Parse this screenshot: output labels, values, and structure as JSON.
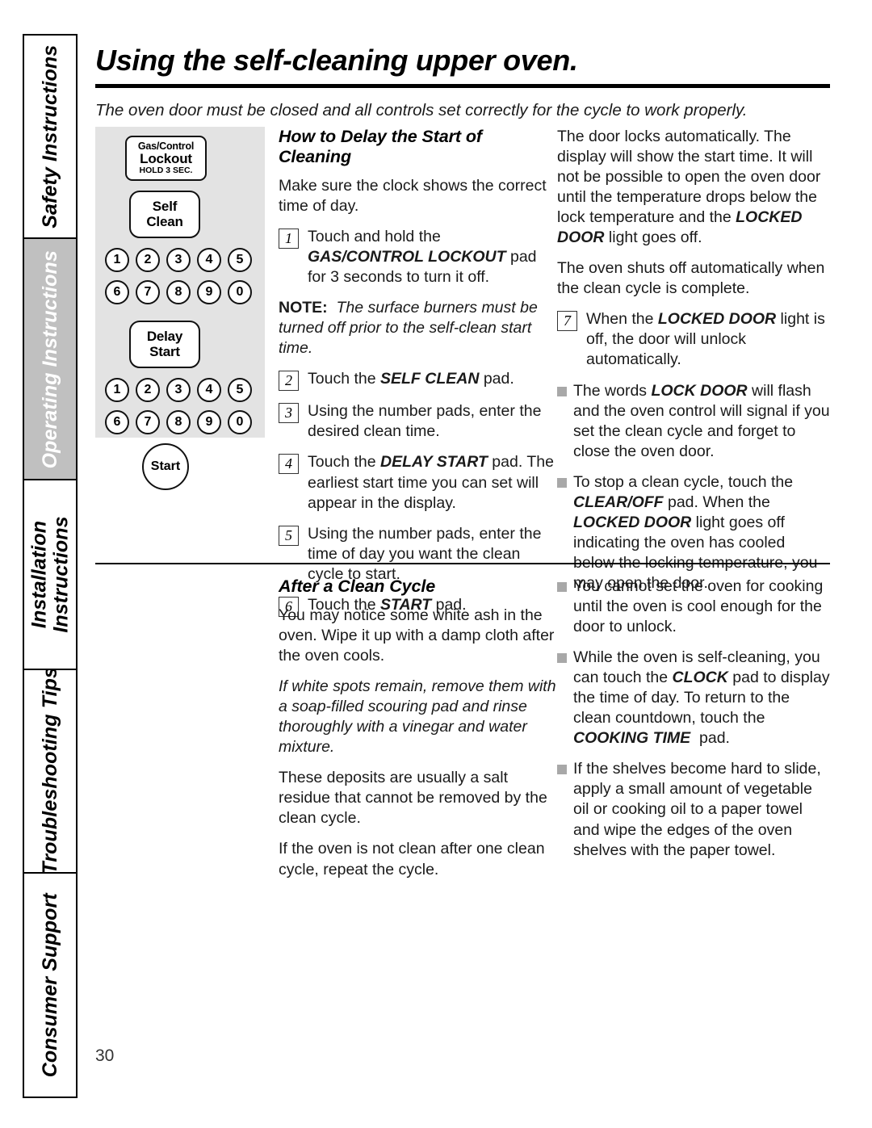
{
  "sidebar": {
    "tabs": [
      {
        "label": "Safety Instructions",
        "active": false
      },
      {
        "label": "Operating Instructions",
        "active": true
      },
      {
        "label": "Installation\nInstructions",
        "active": false
      },
      {
        "label": "Troubleshooting Tips",
        "active": false
      },
      {
        "label": "Consumer Support",
        "active": false
      }
    ]
  },
  "header": {
    "title": "Using the self-cleaning upper oven.",
    "intro": "The oven door must be closed and all controls set correctly for the cycle to work properly."
  },
  "control_panel": {
    "lockout_pad": {
      "line1": "Gas/Control",
      "line2": "Lockout",
      "line3": "HOLD 3 SEC."
    },
    "self_clean_pad": {
      "line1": "Self",
      "line2": "Clean"
    },
    "delay_start_pad": {
      "line1": "Delay",
      "line2": "Start"
    },
    "start_pad": "Start",
    "number_row_1": [
      "1",
      "2",
      "3",
      "4",
      "5"
    ],
    "number_row_2": [
      "6",
      "7",
      "8",
      "9",
      "0"
    ],
    "number_row_3": [
      "1",
      "2",
      "3",
      "4",
      "5"
    ],
    "number_row_4": [
      "6",
      "7",
      "8",
      "9",
      "0"
    ],
    "panel_bg_color": "#e3e3e3"
  },
  "delay_section": {
    "heading": "How to Delay the Start of Cleaning",
    "intro": "Make sure the clock shows the correct time of day.",
    "steps": [
      {
        "num": "1",
        "html": "Touch and hold the <b class=\"bi\">GAS/CONTROL LOCKOUT</b> pad for 3 seconds to turn it off."
      },
      {
        "num": "2",
        "html": "Touch the <b class=\"bi\">SELF CLEAN</b> pad."
      },
      {
        "num": "3",
        "html": "Using the number pads, enter the desired clean time."
      },
      {
        "num": "4",
        "html": "Touch the <b class=\"bi\">DELAY START</b> pad. The earliest start time you can set will appear in the display."
      },
      {
        "num": "5",
        "html": "Using the number pads, enter the time of day you want the clean cycle to start."
      },
      {
        "num": "6",
        "html": "Touch the <b class=\"bi\">START</b> pad."
      }
    ],
    "note_html": "<b>NOTE:</b>&nbsp; <i>The surface burners must be turned off prior to the self-clean start time.</i>",
    "right_para_1_html": "The door locks automatically. The display will show the start time. It will not be possible to open the oven door until the temperature drops below the lock temperature and the <b class=\"bi\">LOCKED DOOR</b> light goes off.",
    "right_para_2": "The oven shuts off automatically when the clean cycle is complete.",
    "right_step_7": {
      "num": "7",
      "html": "When the <b class=\"bi\">LOCKED DOOR</b> light is off, the door will unlock automatically."
    },
    "right_bullets": [
      "The words <b class=\"bi\">LOCK DOOR</b> will flash and the oven control will signal if you set the clean cycle and forget to close the oven door.",
      "To stop a clean cycle, touch the <b class=\"bi\">CLEAR/OFF</b> pad. When the <b class=\"bi\">LOCKED DOOR</b> light goes off indicating the oven has cooled below the locking temperature, you may open the door."
    ]
  },
  "after_section": {
    "heading": "After a Clean Cycle",
    "left_paras": [
      {
        "text": "You may notice some white ash in the oven. Wipe it up with a damp cloth after the oven cools.",
        "italic": false
      },
      {
        "text": "If white spots remain, remove them with a soap-filled scouring pad and rinse thoroughly with a vinegar and water mixture.",
        "italic": true
      },
      {
        "text": "These deposits are usually a salt residue that cannot be removed by the clean cycle.",
        "italic": false
      },
      {
        "text": "If the oven is not clean after one clean cycle, repeat the cycle.",
        "italic": false
      }
    ],
    "right_bullets": [
      "You cannot set the oven for cooking until the oven is cool enough for the door to unlock.",
      "While the oven is self-cleaning, you can touch the <b class=\"bi\">CLOCK</b> pad to display the time of day. To return to the clean countdown, touch the <b class=\"bi\">COOKING TIME</b>&nbsp; pad.",
      "If the shelves become hard to slide, apply a small amount of vegetable oil or cooking oil to a paper towel and wipe the edges of the oven shelves with the paper towel."
    ]
  },
  "footer": {
    "page_number": "30"
  }
}
